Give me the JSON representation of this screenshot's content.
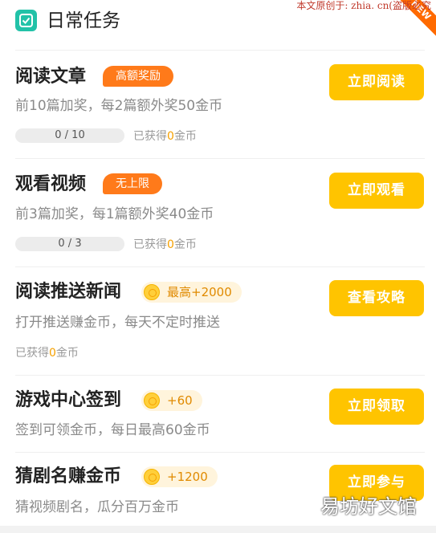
{
  "header": {
    "title": "日常任务",
    "watermark": "本文原创于: zhia. cn(盗版必究",
    "ribbon": "NEW"
  },
  "colors": {
    "accent": "#ffc400",
    "tag_orange": "#ff7a1a",
    "coin_text": "#e08a00",
    "header_icon": "#22c2a8"
  },
  "tasks": [
    {
      "title": "阅读文章",
      "tag": "高额奖励",
      "desc": "前10篇加奖，每2篇额外奖50金币",
      "progress_text": "0 / 10",
      "progress": 0,
      "earned_prefix": "已获得",
      "earned_value": "0",
      "earned_suffix": "金币",
      "button": "立即阅读"
    },
    {
      "title": "观看视频",
      "tag": "无上限",
      "desc": "前3篇加奖，每1篇额外奖40金币",
      "progress_text": "0 / 3",
      "progress": 0,
      "earned_prefix": "已获得",
      "earned_value": "0",
      "earned_suffix": "金币",
      "button": "立即观看"
    },
    {
      "title": "阅读推送新闻",
      "coin_tag": "最高+2000",
      "desc": "打开推送赚金币，每天不定时推送",
      "earned_prefix": "已获得",
      "earned_value": "0",
      "earned_suffix": "金币",
      "button": "查看攻略"
    },
    {
      "title": "游戏中心签到",
      "coin_tag": "+60",
      "desc": "签到可领金币，每日最高60金币",
      "button": "立即领取"
    },
    {
      "title": "猜剧名赚金币",
      "coin_tag": "+1200",
      "desc": "猜视频剧名，瓜分百万金币",
      "button": "立即参与"
    }
  ],
  "footer": {
    "watermark": "易坊好文馆"
  }
}
